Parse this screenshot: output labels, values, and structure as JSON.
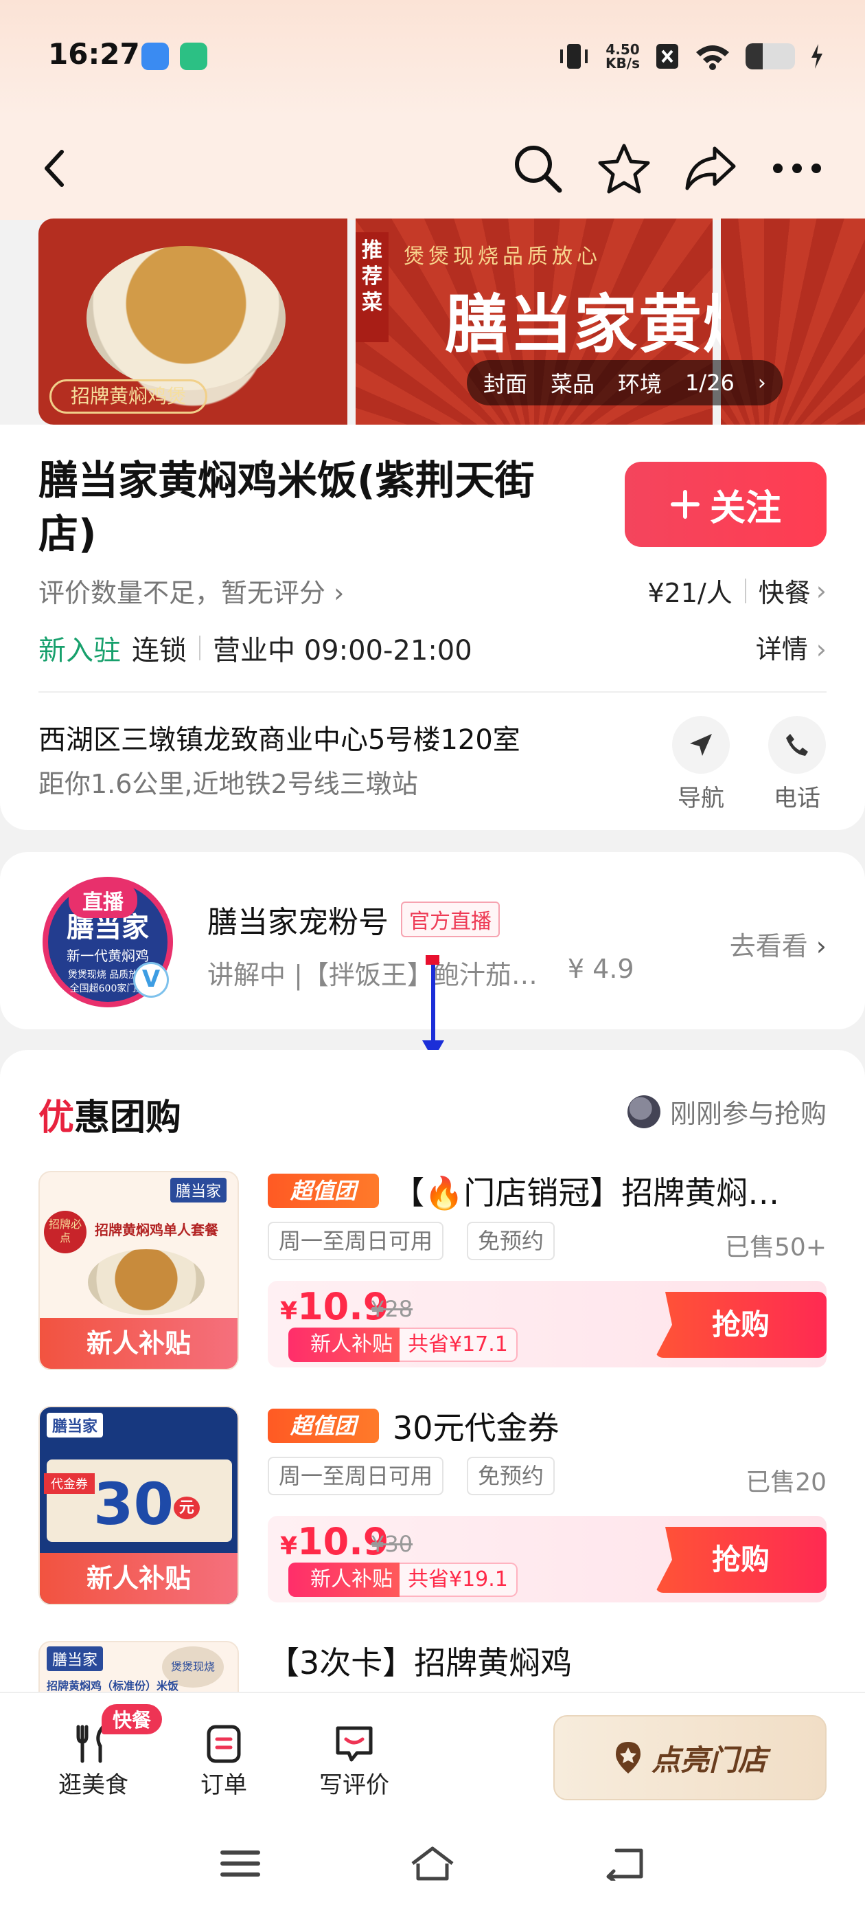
{
  "status_bar": {
    "time": "16:27",
    "net_speed_value": "4.50",
    "net_speed_unit": "KB/s",
    "battery_level": 0.35
  },
  "header": {
    "icons": [
      "back-icon",
      "search-icon",
      "star-icon",
      "share-icon",
      "more-icon"
    ]
  },
  "banner": {
    "recommend_tag": "推荐菜",
    "slogan": "煲煲现烧品质放心",
    "brand_text": "膳当家黄焖鸡",
    "stamp_text": "招牌黄焖鸡煲",
    "gallery_tabs": [
      "封面",
      "菜品",
      "环境"
    ],
    "counter": "1/26"
  },
  "store": {
    "name": "膳当家黄焖鸡米饭(紫荆天街店)",
    "follow_label": "关注",
    "rating_text": "评价数量不足，暂无评分",
    "price_per_person": "¥21/人",
    "category": "快餐",
    "new_tag": "新入驻",
    "chain_tag": "连锁",
    "hours": "营业中 09:00-21:00",
    "details_label": "详情",
    "address": "西湖区三墩镇龙致商业中心5号楼120室",
    "distance": "距你1.6公里,近地铁2号线三墩站",
    "nav_label": "导航",
    "phone_label": "电话"
  },
  "live": {
    "live_pill": "直播",
    "avatar_brand": "膳当家",
    "avatar_sub": "新一代黄焖鸡",
    "avatar_line": "煲煲现烧 品质放心",
    "avatar_count": "全国超600家门店",
    "name": "膳当家宠粉号",
    "official_tag": "官方直播",
    "desc": "讲解中 |【拌饭王】鲍汁茄…",
    "price": "¥ 4.9",
    "goto_label": "去看看"
  },
  "deals": {
    "title_first": "优",
    "title_rest": "惠团购",
    "recent_label": "刚刚参与抢购",
    "items": [
      {
        "badge": "超值团",
        "title": "【🔥门店销冠】招牌黄焖…",
        "chip1": "周一至周日可用",
        "chip2": "免预约",
        "sold": "已售50+",
        "price_symbol": "¥",
        "price": "10.9",
        "orig": "¥28",
        "new_tag": "新人补贴",
        "save": "共省¥17.1",
        "grab": "抢购",
        "thumb_subsidy": "新人补贴",
        "thumb_brand": "膳当家",
        "thumb_title": "招牌黄焖鸡单人套餐",
        "thumb_seal": "招牌必点"
      },
      {
        "badge": "超值团",
        "title": "30元代金券",
        "chip1": "周一至周日可用",
        "chip2": "免预约",
        "sold": "已售20",
        "price_symbol": "¥",
        "price": "10.9",
        "orig": "¥30",
        "new_tag": "新人补贴",
        "save": "共省¥19.1",
        "grab": "抢购",
        "thumb_subsidy": "新人补贴",
        "thumb_brand": "膳当家",
        "thumb_voucher": "代金券",
        "thumb_amount": "30",
        "thumb_unit": "元"
      },
      {
        "title": "【3次卡】招牌黄焖鸡",
        "thumb_brand": "膳当家",
        "thumb_title": "招牌黄焖鸡（标准份）米饭",
        "thumb_seal": "煲煲现烧"
      }
    ]
  },
  "tabbar": {
    "food": "逛美食",
    "food_badge": "快餐",
    "orders": "订单",
    "review": "写评价",
    "light_up": "点亮门店"
  },
  "colors": {
    "accent": "#ff2948",
    "green": "#17a06c",
    "follow": "#f4455d"
  }
}
